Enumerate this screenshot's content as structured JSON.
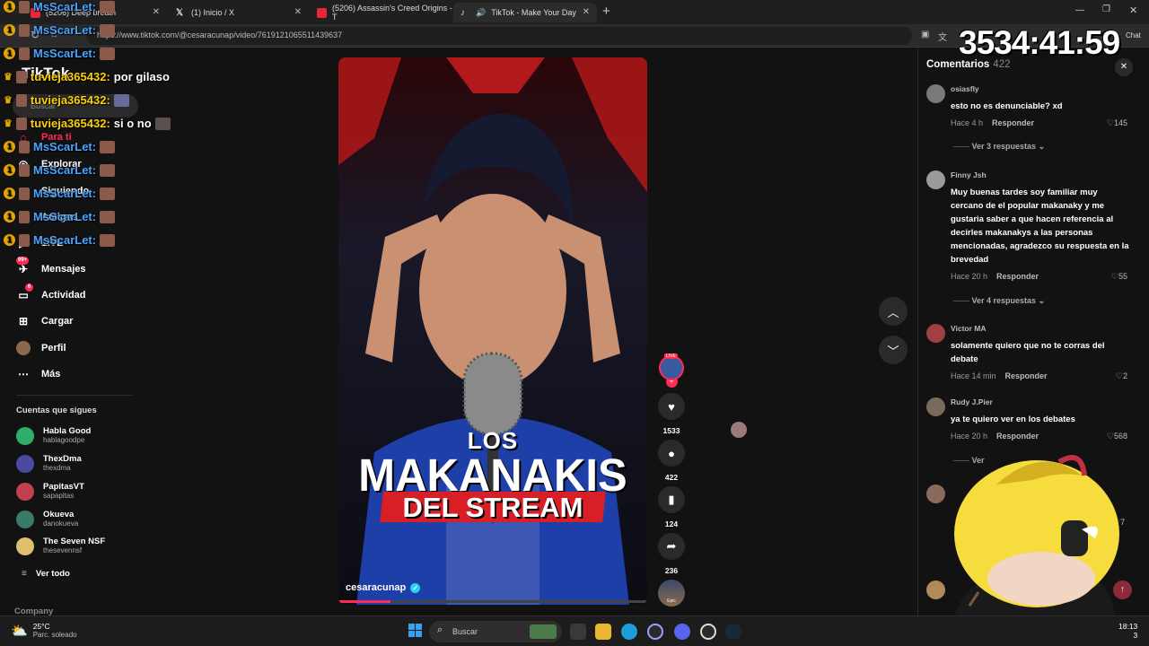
{
  "browser": {
    "tabs": [
      {
        "label": "(5206) Deep breath",
        "label_tail": "p Breath",
        "color": "#e8263a"
      },
      {
        "label": "(1) Inicio / X",
        "color": "#ffffff"
      },
      {
        "label": "(5206) Assassin's Creed Origins - T",
        "color": "#e8263a"
      },
      {
        "label": "TikTok - Make Your Day",
        "color": "#25f4ee"
      }
    ],
    "new_tab": "+",
    "url": "https://www.tiktok.com/@cesaracunap/video/7619121065511439637",
    "chat_btn": "Chat"
  },
  "timer": "3534:41:59",
  "stream_chat": [
    {
      "badge": "1",
      "user": "MsScarLet:",
      "msg": "",
      "user_color": "#4aa3ff"
    },
    {
      "badge": "1",
      "user": "MsScarLet:",
      "msg": "",
      "user_color": "#4aa3ff"
    },
    {
      "badge": "1",
      "user": "MsScarLet:",
      "msg": "",
      "user_color": "#4aa3ff"
    },
    {
      "badge": "crown",
      "user": "tuvieja365432:",
      "msg": "por gilaso",
      "user_color": "#ffd000"
    },
    {
      "badge": "crown",
      "user": "tuvieja365432:",
      "msg": "",
      "user_color": "#ffd000"
    },
    {
      "badge": "crown",
      "user": "tuvieja365432:",
      "msg": "si o no",
      "user_color": "#ffd000"
    },
    {
      "badge": "1",
      "user": "MsScarLet:",
      "msg": "",
      "user_color": "#4aa3ff"
    },
    {
      "badge": "1",
      "user": "MsScarLet:",
      "msg": "",
      "user_color": "#4aa3ff"
    },
    {
      "badge": "1",
      "user": "MsScarLet:",
      "msg": "",
      "user_color": "#4aa3ff"
    },
    {
      "badge": "1",
      "user": "MsScarLet:",
      "msg": "",
      "user_color": "#4aa3ff"
    },
    {
      "badge": "1",
      "user": "MsScarLet:",
      "msg": "",
      "user_color": "#4aa3ff"
    }
  ],
  "tiktok": {
    "logo": "TikTok",
    "search_placeholder": "Buscar",
    "nav": [
      {
        "icon": "home-icon",
        "label": "Para ti",
        "color": "#fe2c55"
      },
      {
        "icon": "compass-icon",
        "label": "Explorar"
      },
      {
        "icon": "following-icon",
        "label": "Siguiendo"
      },
      {
        "icon": "friends-icon",
        "label": "Amigos"
      },
      {
        "icon": "live-icon",
        "label": "LIVE"
      },
      {
        "icon": "messages-icon",
        "label": "Mensajes",
        "badge": "99+"
      },
      {
        "icon": "activity-icon",
        "label": "Actividad",
        "badge": "6"
      },
      {
        "icon": "upload-icon",
        "label": "Cargar"
      },
      {
        "icon": "profile-icon",
        "label": "Perfil"
      },
      {
        "icon": "more-icon",
        "label": "Más"
      }
    ],
    "following_title": "Cuentas que sigues",
    "following": [
      {
        "name": "Habla Good",
        "handle": "hablagoodpe",
        "color": "#2fae6a"
      },
      {
        "name": "ThexDma",
        "handle": "thexdma",
        "color": "#4a4aa0"
      },
      {
        "name": "PapitasVT",
        "handle": "sapapitas",
        "color": "#c04050"
      },
      {
        "name": "Okueva",
        "handle": "danokueva",
        "color": "#3a7a6a"
      },
      {
        "name": "The Seven NSF",
        "handle": "thesevennsf",
        "color": "#e0c070"
      }
    ],
    "see_all": "Ver todo",
    "company": "Company"
  },
  "video": {
    "line1": "LOS",
    "line2": "MAKANAKIS",
    "line3": "DEL STREAM",
    "author": "cesaracunap",
    "likes": "1533",
    "comments": "422",
    "saves": "124",
    "shares": "236",
    "live_tag": "LIVE",
    "music_tag": "Epic"
  },
  "comments_panel": {
    "title": "Comentarios",
    "count": "422",
    "items": [
      {
        "user": "osiasfly",
        "text": "esto no es denunciable? xd",
        "time": "Hace 4 h",
        "reply": "Responder",
        "likes": "145",
        "more": "Ver 3 respuestas",
        "color": "#7a7a7a"
      },
      {
        "user": "Finny Jsh",
        "text": "Muy buenas tardes soy familiar muy cercano de el popular makanaky y me gustaria saber a que hacen referencia al decirles makanakys a las personas mencionadas, agradezco su respuesta en la brevedad",
        "time": "Hace 20 h",
        "reply": "Responder",
        "likes": "55",
        "more": "Ver 4 respuestas",
        "color": "#9a9a9a"
      },
      {
        "user": "Victor MA",
        "text": "solamente quiero que no te corras del debate",
        "time": "Hace 14 min",
        "reply": "Responder",
        "likes": "2",
        "more": "",
        "color": "#a04040"
      },
      {
        "user": "Rudy J.Pier",
        "text": "ya te quiero ver en los debates",
        "time": "Hace 20 h",
        "reply": "Responder",
        "likes": "568",
        "more": "Ver",
        "color": "#7a6a5a"
      }
    ],
    "hidden_like": "7"
  },
  "taskbar": {
    "weather_temp": "25°C",
    "weather_desc": "Parc. soleado",
    "search": "Buscar",
    "time": "18:13",
    "date_tail": "3"
  }
}
